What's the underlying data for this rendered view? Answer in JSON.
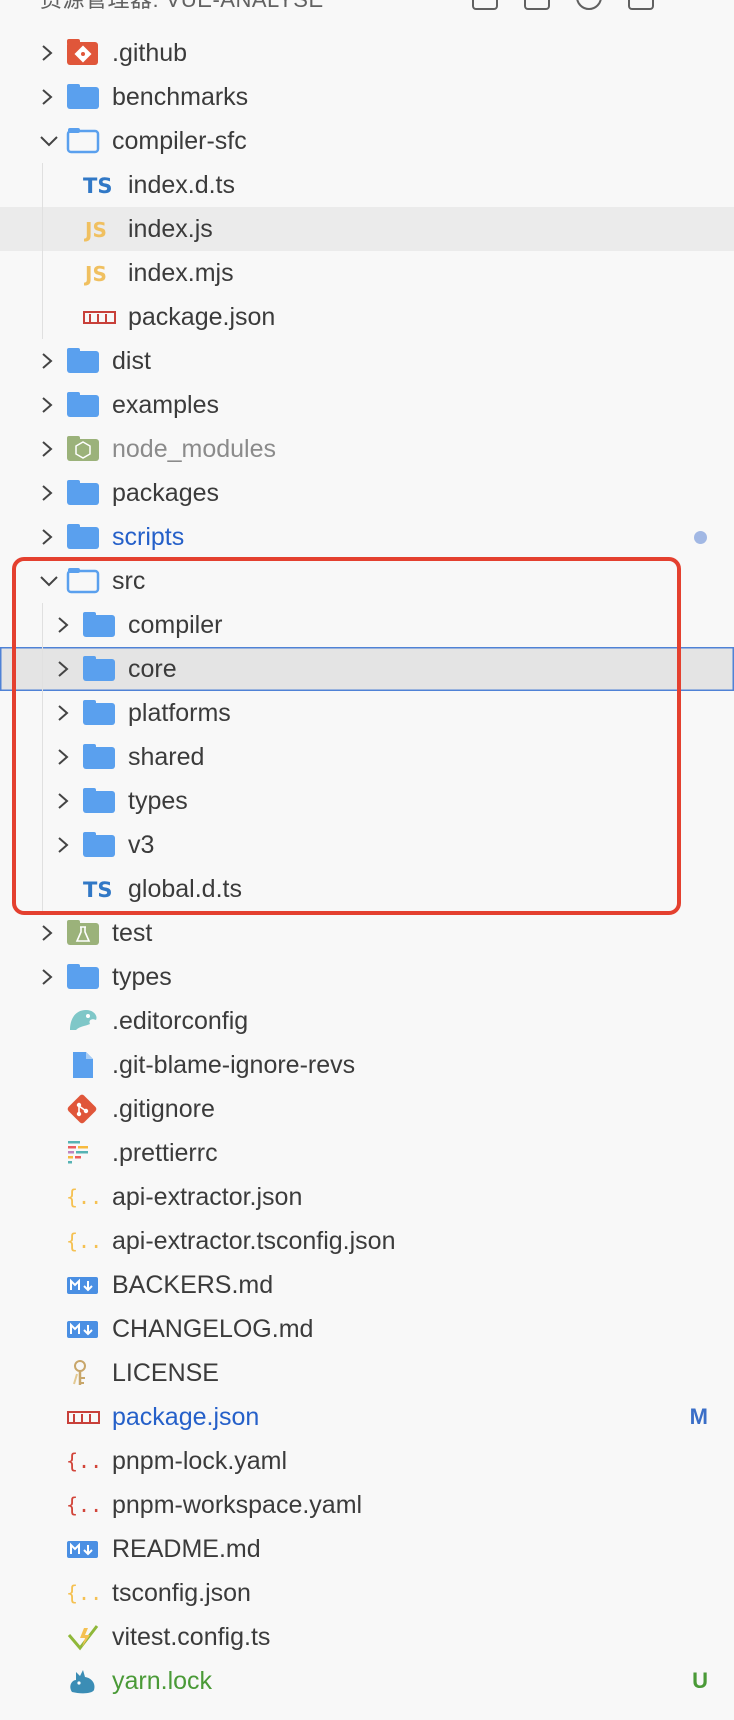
{
  "explorer": {
    "title": "资源管理器: VUE-ANALYSE"
  },
  "colors": {
    "folder": "#5aa0ee",
    "modified": "#2560c9",
    "untracked": "#4a9a37",
    "highlight_border": "#e4402f",
    "focus_border": "#4f82d6"
  },
  "tree": {
    "github": ".github",
    "benchmarks": "benchmarks",
    "compiler_sfc": "compiler-sfc",
    "compiler_sfc_files": {
      "index_d_ts": "index.d.ts",
      "index_js": "index.js",
      "index_mjs": "index.mjs",
      "package_json": "package.json"
    },
    "dist": "dist",
    "examples": "examples",
    "node_modules": "node_modules",
    "packages": "packages",
    "scripts": "scripts",
    "src": "src",
    "src_children": {
      "compiler": "compiler",
      "core": "core",
      "platforms": "platforms",
      "shared": "shared",
      "types": "types",
      "v3": "v3",
      "global_d_ts": "global.d.ts"
    },
    "test": "test",
    "types": "types",
    "root_files": {
      "editorconfig": ".editorconfig",
      "git_blame": ".git-blame-ignore-revs",
      "gitignore": ".gitignore",
      "prettierrc": ".prettierrc",
      "api_extractor": "api-extractor.json",
      "api_extractor_tsconfig": "api-extractor.tsconfig.json",
      "backers": "BACKERS.md",
      "changelog": "CHANGELOG.md",
      "license": "LICENSE",
      "package_json": "package.json",
      "pnpm_lock": "pnpm-lock.yaml",
      "pnpm_workspace": "pnpm-workspace.yaml",
      "readme": "README.md",
      "tsconfig": "tsconfig.json",
      "vitest_config": "vitest.config.ts",
      "yarn_lock": "yarn.lock"
    }
  },
  "badges": {
    "modified": "M",
    "untracked": "U"
  },
  "icon_names": {
    "folder": "folder-icon",
    "folder_open": "folder-open-icon",
    "ts": "typescript-icon",
    "js": "javascript-icon",
    "npm": "npm-icon",
    "markdown": "markdown-icon",
    "json": "json-braces-icon",
    "yaml": "yaml-braces-icon"
  }
}
